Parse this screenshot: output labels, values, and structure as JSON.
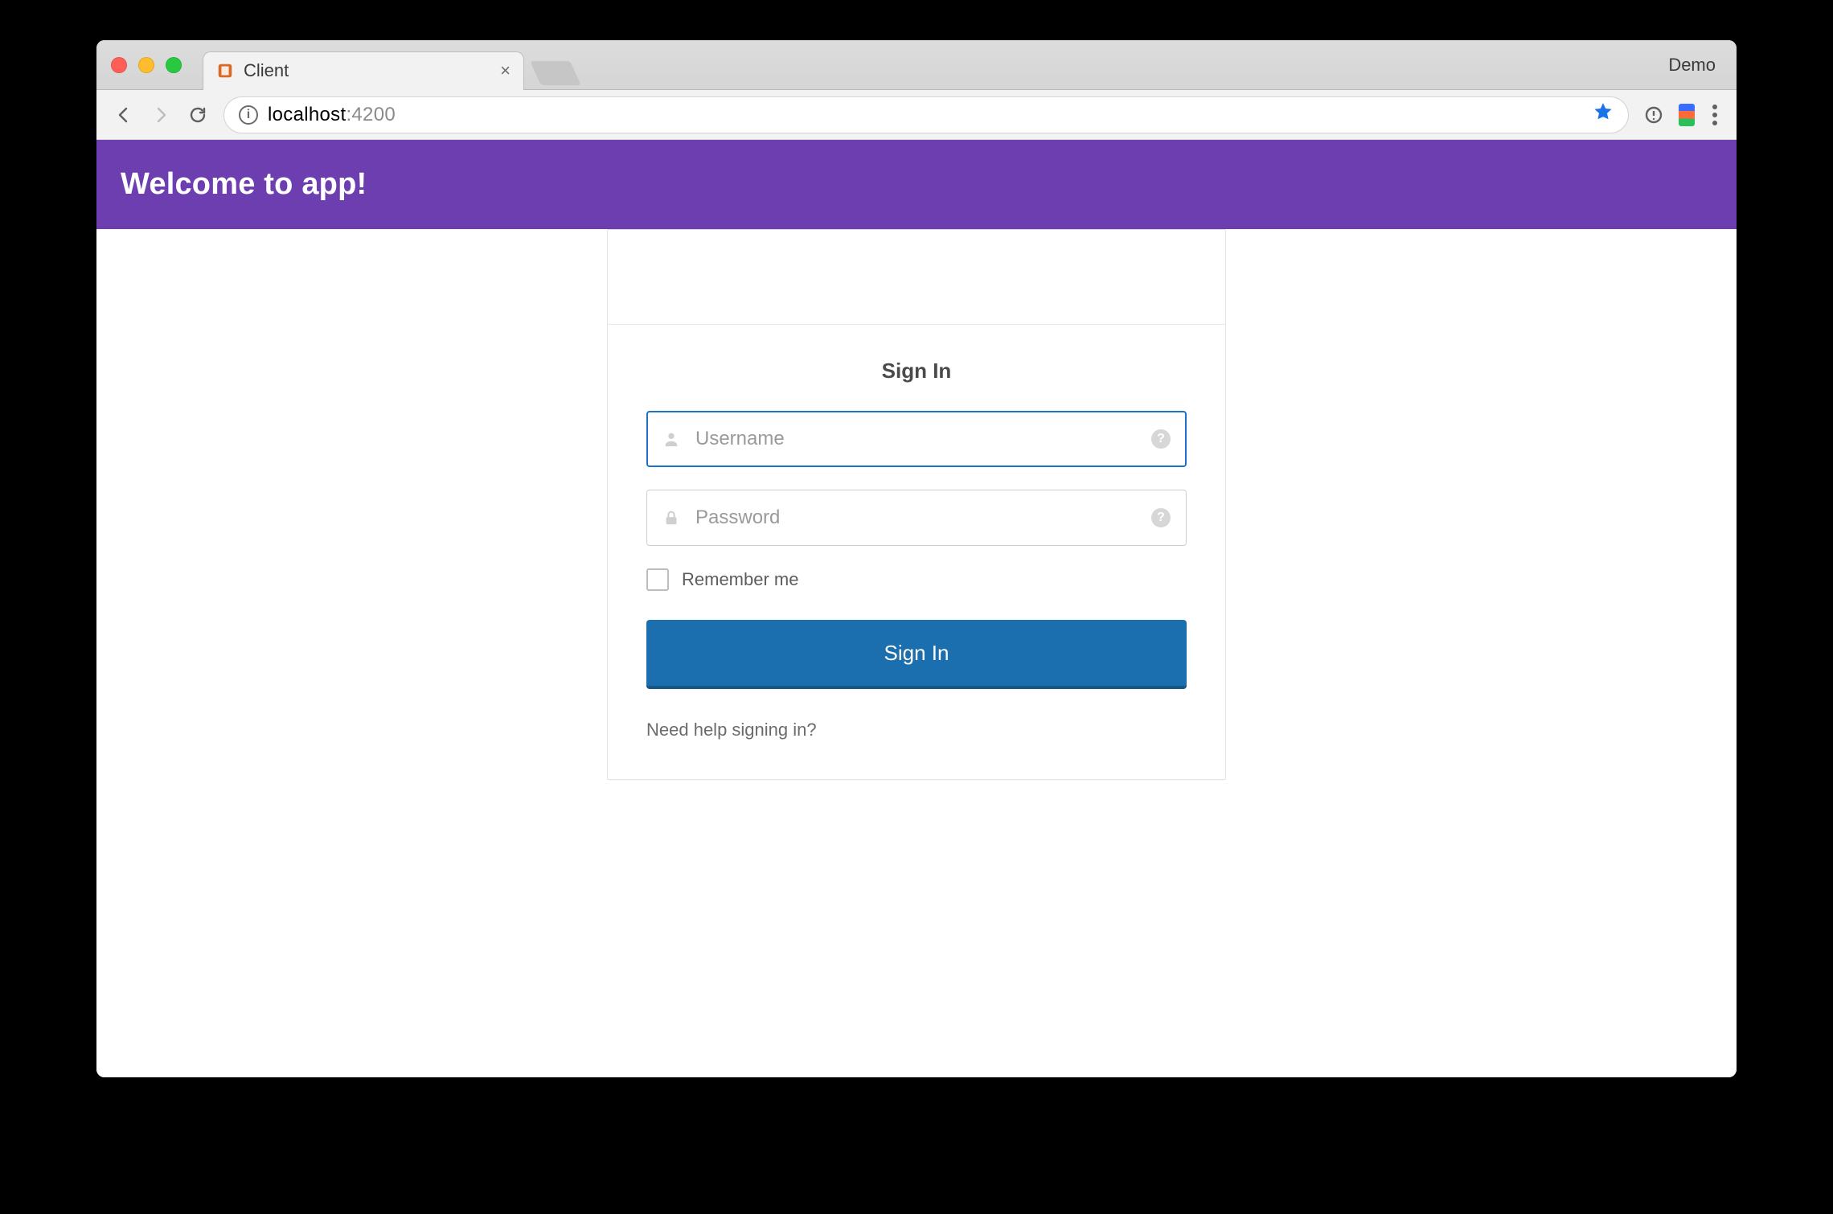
{
  "browser": {
    "tab_title": "Client",
    "window_label_right": "Demo",
    "url_host": "localhost",
    "url_port": ":4200"
  },
  "banner": {
    "title": "Welcome to app!"
  },
  "signin": {
    "heading": "Sign In",
    "username_placeholder": "Username",
    "password_placeholder": "Password",
    "remember_label": "Remember me",
    "submit_label": "Sign In",
    "help_link": "Need help signing in?"
  },
  "colors": {
    "banner_bg": "#6c3eb0",
    "primary_button": "#1c6fae",
    "focus_border": "#1a73c8"
  }
}
